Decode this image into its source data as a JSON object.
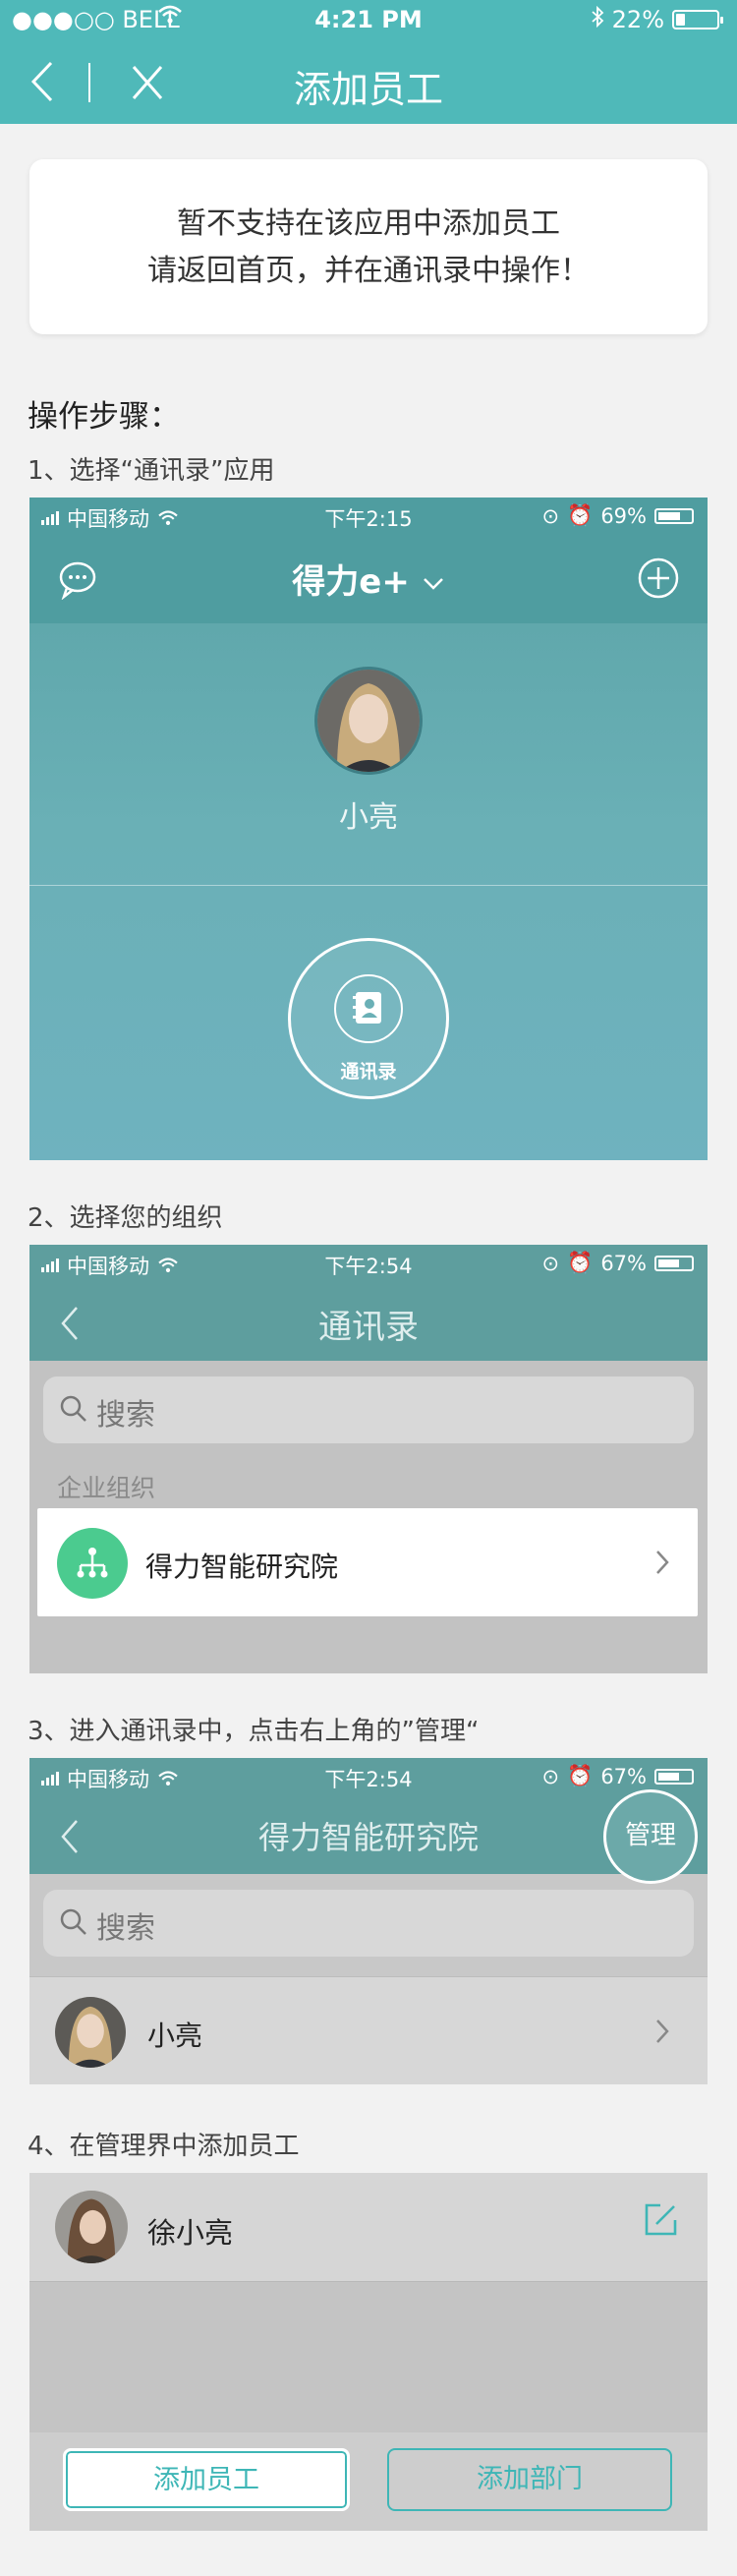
{
  "status_bar": {
    "carrier": "●●●○○ BELL",
    "time": "4:21 PM",
    "battery": "22%",
    "battery_level": 0.22
  },
  "nav": {
    "title": "添加员工"
  },
  "notice": {
    "line1": "暂不支持在该应用中添加员工",
    "line2": "请返回首页，并在通讯录中操作！"
  },
  "steps_title": "操作步骤：",
  "steps": [
    {
      "label": "1、选择“通讯录”应用"
    },
    {
      "label": "2、选择您的组织"
    },
    {
      "label": "3、进入通讯录中，点击右上角的”管理“"
    },
    {
      "label": "4、在管理界中添加员工"
    }
  ],
  "shot1": {
    "status": {
      "carrier": "中国移动",
      "time": "下午2:15",
      "battery": "69%",
      "battery_level": 0.69
    },
    "brand": "得力e+",
    "user_name": "小亮",
    "contacts_label": "通讯录"
  },
  "shot2": {
    "status": {
      "carrier": "中国移动",
      "time": "下午2:54",
      "battery": "67%",
      "battery_level": 0.67
    },
    "title": "通讯录",
    "search_placeholder": "搜索",
    "section_label": "企业组织",
    "org_name": "得力智能研究院"
  },
  "shot3": {
    "status": {
      "carrier": "中国移动",
      "time": "下午2:54",
      "battery": "67%",
      "battery_level": 0.67
    },
    "title": "得力智能研究院",
    "manage_label": "管理",
    "search_placeholder": "搜索",
    "member_name": "小亮"
  },
  "shot4": {
    "member_name": "徐小亮",
    "add_employee_label": "添加员工",
    "add_department_label": "添加部门"
  },
  "colors": {
    "accent": "#4fb9b9",
    "org_icon": "#4bcb8f"
  }
}
